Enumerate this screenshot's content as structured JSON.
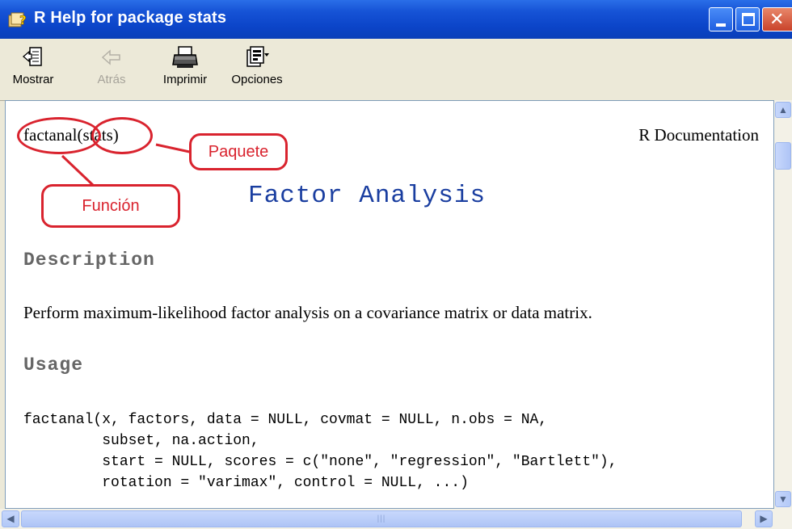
{
  "window": {
    "title": "R Help for package stats"
  },
  "toolbar": {
    "buttons": [
      {
        "label": "Mostrar",
        "icon": "show-contents-icon",
        "enabled": true
      },
      {
        "label": "Atrás",
        "icon": "back-arrow-icon",
        "enabled": false
      },
      {
        "label": "Imprimir",
        "icon": "printer-icon",
        "enabled": true
      },
      {
        "label": "Opciones",
        "icon": "options-icon",
        "enabled": true
      }
    ]
  },
  "doc": {
    "header_left": "factanal(stats)",
    "header_right": "R Documentation",
    "title": "Factor Analysis",
    "description_heading": "Description",
    "description_text": "Perform maximum-likelihood factor analysis on a covariance matrix or data matrix.",
    "usage_heading": "Usage",
    "usage_code": "factanal(x, factors, data = NULL, covmat = NULL, n.obs = NA,\n         subset, na.action,\n         start = NULL, scores = c(\"none\", \"regression\", \"Bartlett\"),\n         rotation = \"varimax\", control = NULL, ...)"
  },
  "annotations": {
    "package_label": "Paquete",
    "function_label": "Función",
    "color": "#d9232e"
  },
  "colors": {
    "title_bar": "#0b44c8",
    "doc_title": "#1a3ea0",
    "section_heading": "#666666"
  }
}
